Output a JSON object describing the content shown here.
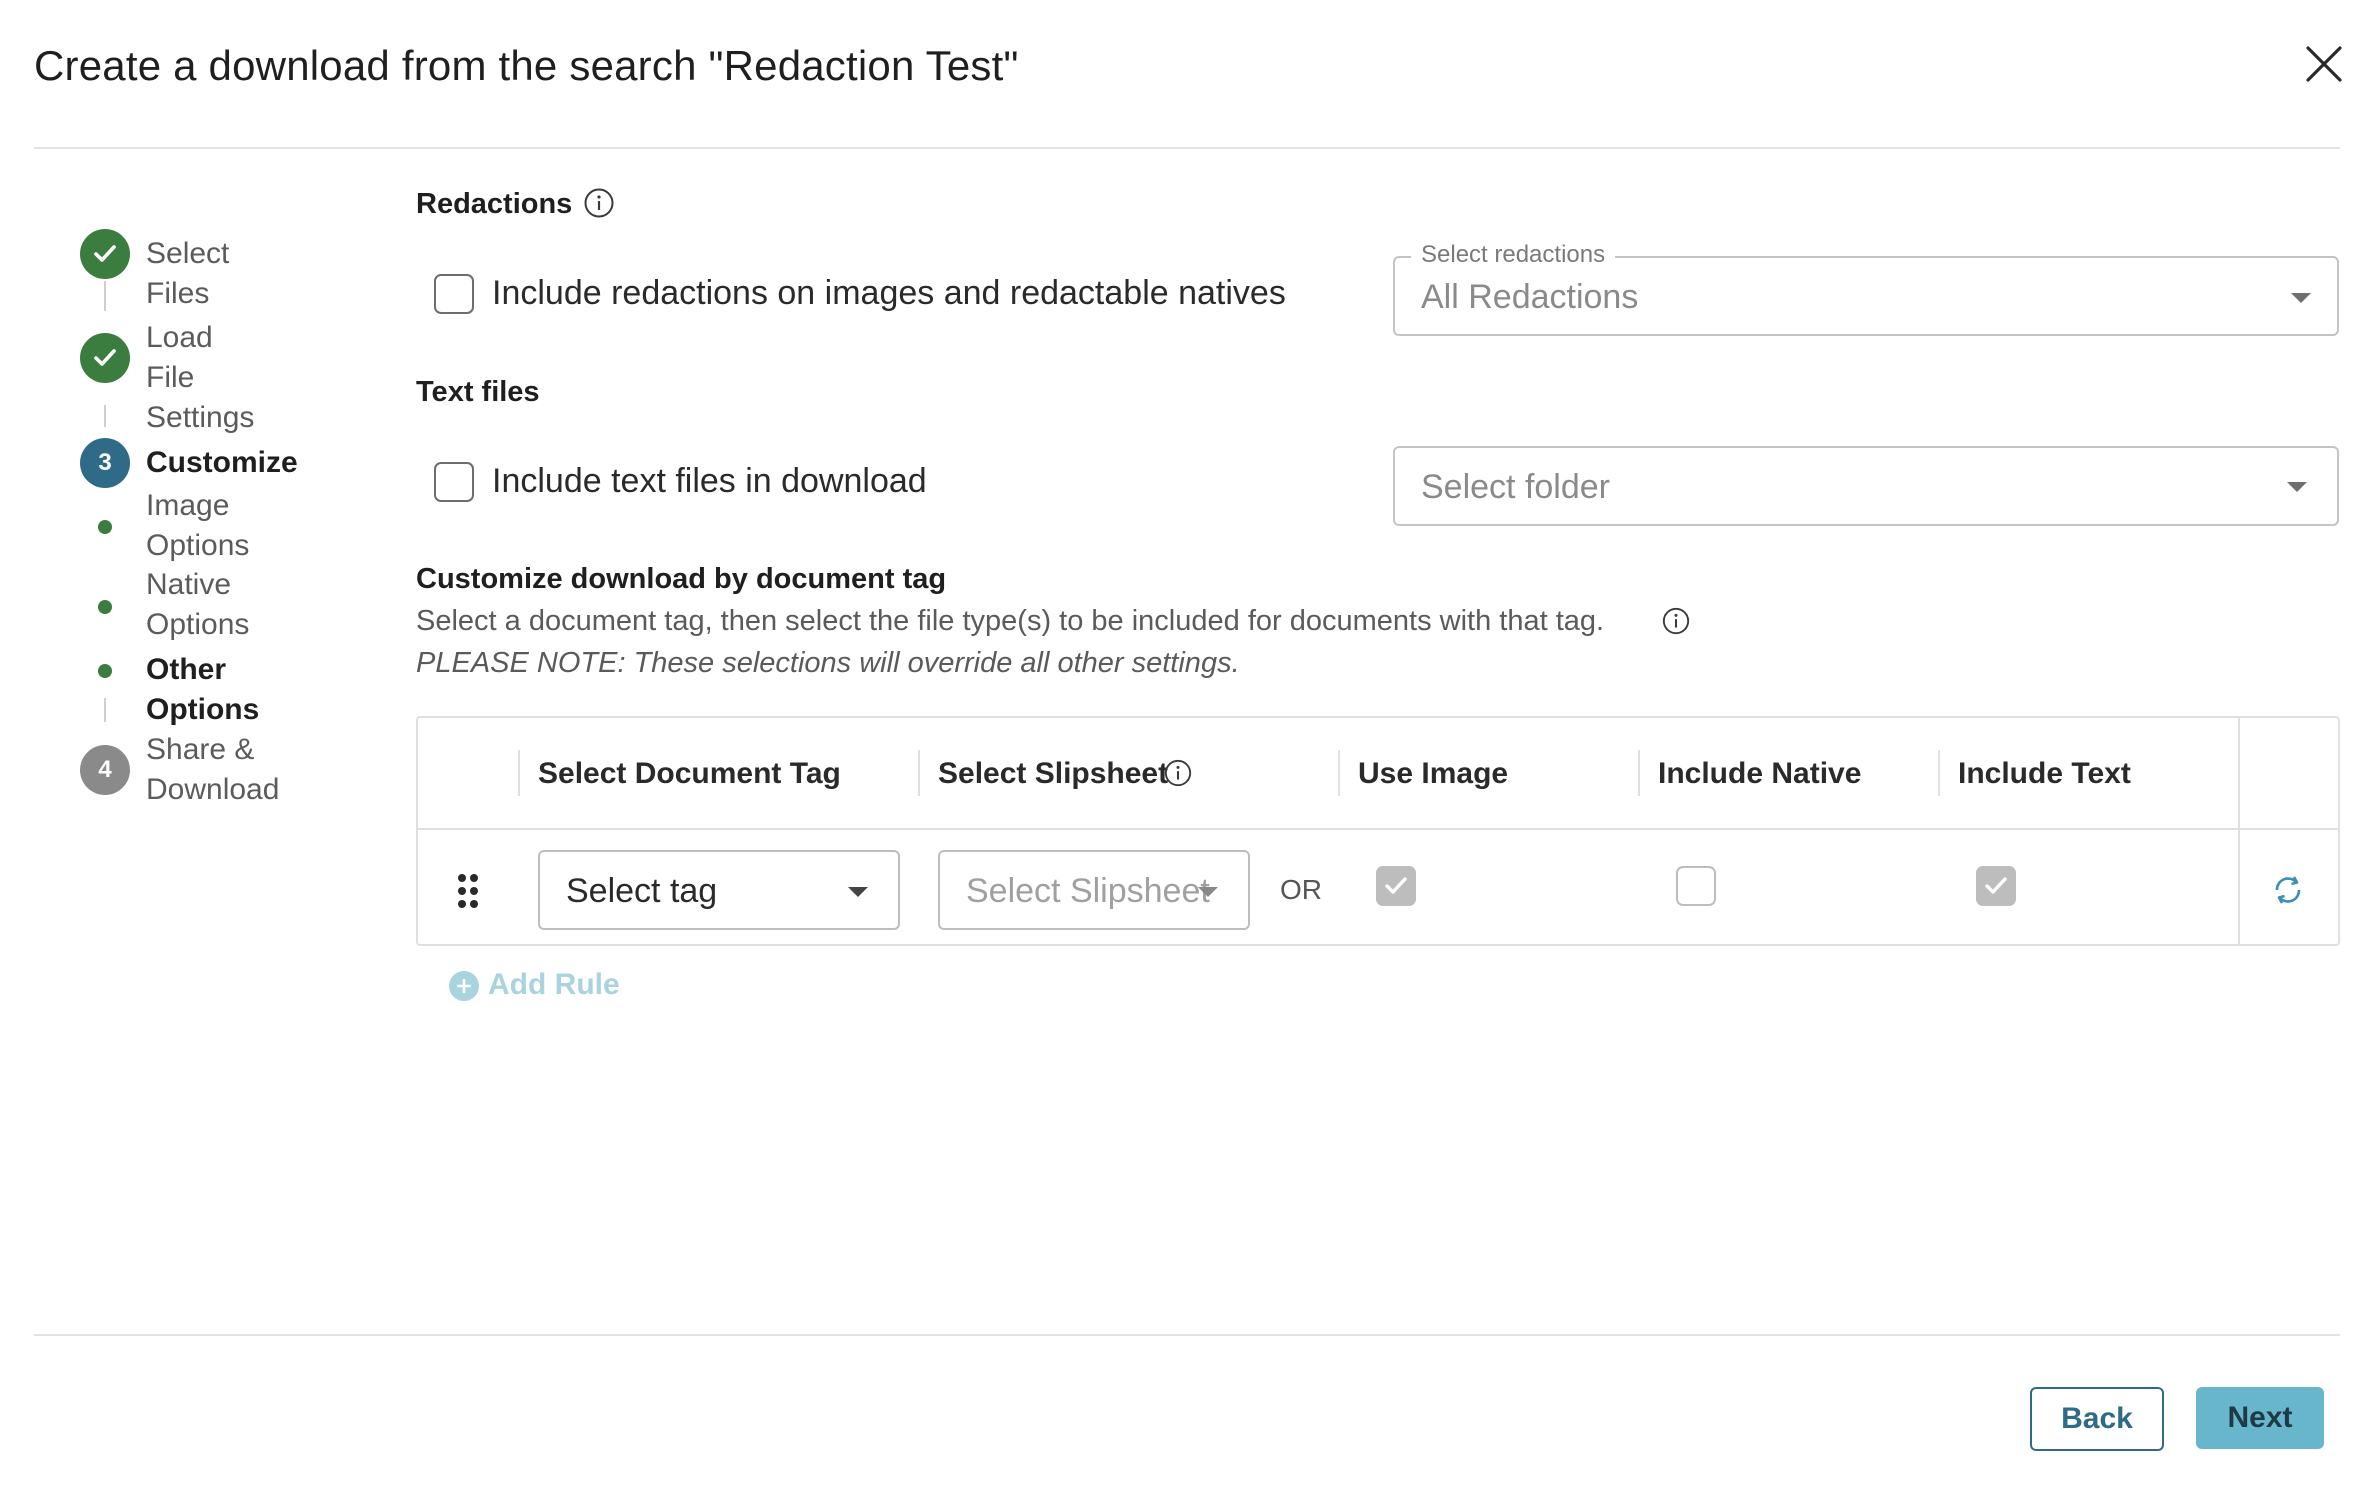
{
  "dialog": {
    "title": "Create a download from the search \"Redaction Test\""
  },
  "stepper": {
    "steps": [
      {
        "label": "Select Files",
        "status": "complete"
      },
      {
        "label_line1": "Load File",
        "label_line2": "Settings",
        "status": "complete"
      },
      {
        "number": "3",
        "label": "Customize",
        "status": "active",
        "substeps": [
          {
            "line1": "Image",
            "line2": "Options"
          },
          {
            "line1": "Native",
            "line2": "Options"
          },
          {
            "line1": "Other Options"
          }
        ]
      },
      {
        "number": "4",
        "label_line1": "Share &",
        "label_line2": "Download",
        "status": "pending"
      }
    ]
  },
  "redactions": {
    "title": "Redactions",
    "checkbox_label": "Include redactions on images and redactable natives",
    "checked": false,
    "select_legend": "Select redactions",
    "select_value": "All Redactions"
  },
  "text_files": {
    "title": "Text files",
    "checkbox_label": "Include text files in download",
    "checked": false,
    "select_placeholder": "Select folder"
  },
  "customize": {
    "title": "Customize download by document tag",
    "description": "Select a document tag, then select the file type(s) to be included for documents with that tag.",
    "note": "PLEASE NOTE: These selections will override all other settings."
  },
  "table": {
    "headers": {
      "tag": "Select Document Tag",
      "slipsheet": "Select Slipsheet",
      "use_image": "Use Image",
      "include_native": "Include Native",
      "include_text": "Include Text"
    },
    "row": {
      "tag_value": "Select tag",
      "slipsheet_placeholder": "Select Slipsheet",
      "or_text": "OR",
      "use_image": true,
      "include_native": false,
      "include_text": true
    }
  },
  "add_rule_label": "Add Rule",
  "footer": {
    "back_label": "Back",
    "next_label": "Next"
  },
  "colors": {
    "complete_green": "#3a7d3f",
    "active_blue": "#2f6b86",
    "next_button": "#68b6cc"
  }
}
